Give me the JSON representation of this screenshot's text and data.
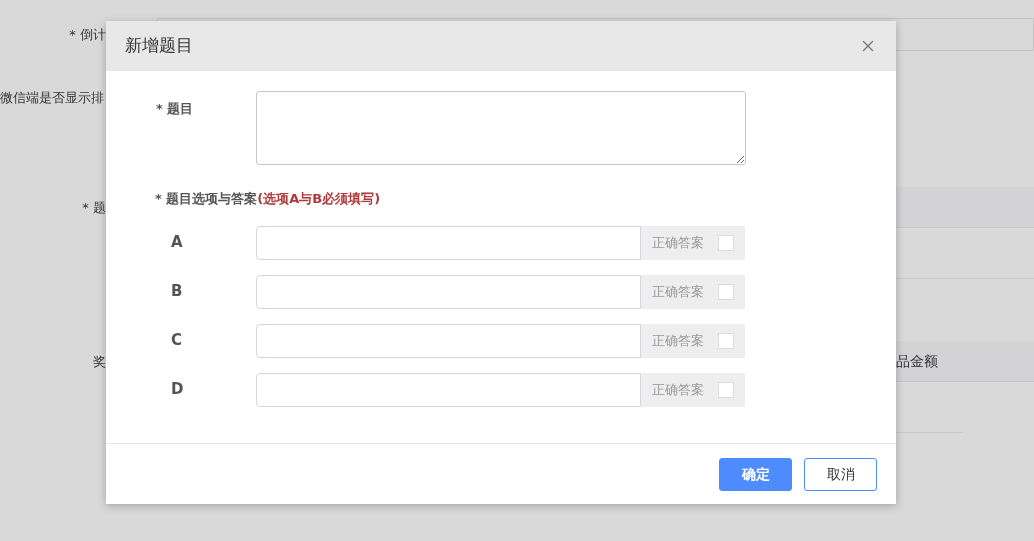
{
  "background": {
    "countdown_label": "* 倒计",
    "ranking_label": "微信端是否显示排",
    "question_label": "* 题",
    "prize_label": "奖",
    "amount_text": "品金额"
  },
  "dialog": {
    "title": "新增题目",
    "question_label": "* 题目",
    "options_heading": "* 题目选项与答案",
    "options_note": "(选项A与B必须填写)",
    "options": [
      {
        "letter": "A",
        "answer_label": "正确答案",
        "checked": false
      },
      {
        "letter": "B",
        "answer_label": "正确答案",
        "checked": false
      },
      {
        "letter": "C",
        "answer_label": "正确答案",
        "checked": false
      },
      {
        "letter": "D",
        "answer_label": "正确答案",
        "checked": false
      }
    ],
    "buttons": [
      {
        "label": "确定",
        "kind": "primary"
      },
      {
        "label": "取消",
        "kind": "secondary"
      }
    ]
  }
}
